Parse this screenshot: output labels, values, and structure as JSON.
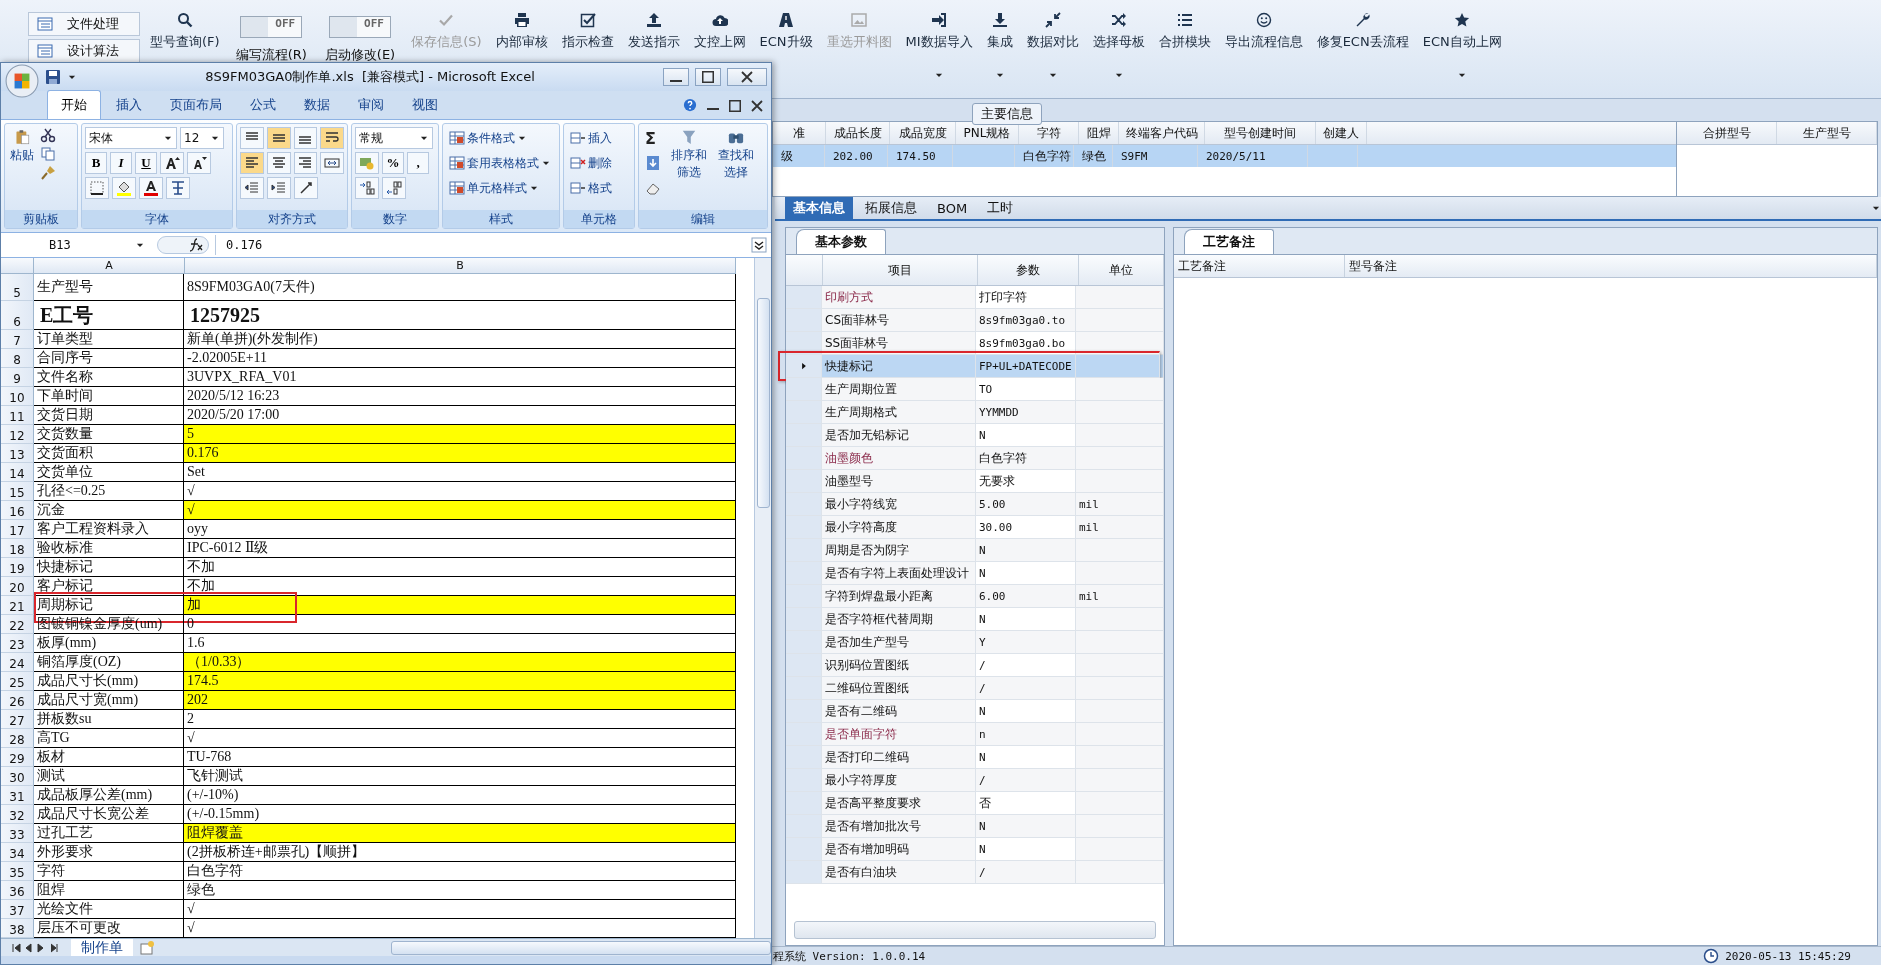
{
  "app": {
    "sidebar": {
      "items": [
        {
          "label": "文件处理"
        },
        {
          "label": "设计算法"
        }
      ]
    },
    "toolbar": [
      {
        "kind": "button",
        "label": "型号查询(F)",
        "disabled": false
      },
      {
        "kind": "toggle",
        "label": "编写流程(R)",
        "toggle_text": "OFF",
        "on": false
      },
      {
        "kind": "toggle",
        "label": "启动修改(E)",
        "toggle_text": "OFF",
        "on": false
      },
      {
        "kind": "button",
        "label": "保存信息(S)",
        "disabled": true
      },
      {
        "kind": "button",
        "label": "内部审核",
        "disabled": false
      },
      {
        "kind": "button",
        "label": "指示检查",
        "disabled": false
      },
      {
        "kind": "button",
        "label": "发送指示",
        "disabled": false
      },
      {
        "kind": "button",
        "label": "文控上网",
        "disabled": false
      },
      {
        "kind": "button",
        "label": "ECN升级",
        "disabled": false
      },
      {
        "kind": "button",
        "label": "重选开料图",
        "disabled": true
      },
      {
        "kind": "dropdown_button",
        "label": "MI数据导入",
        "disabled": false
      },
      {
        "kind": "dropdown_button",
        "label": "集成",
        "disabled": false
      },
      {
        "kind": "dropdown_button",
        "label": "数据对比",
        "disabled": false
      },
      {
        "kind": "dropdown_button",
        "label": "选择母板",
        "disabled": false
      },
      {
        "kind": "button",
        "label": "合拼模块",
        "disabled": false
      },
      {
        "kind": "button",
        "label": "导出流程信息",
        "disabled": false
      },
      {
        "kind": "button",
        "label": "修复ECN丢流程",
        "disabled": false
      },
      {
        "kind": "dropdown_button",
        "label": "ECN自动上网",
        "disabled": false
      }
    ],
    "main_info": {
      "title": "主要信息",
      "columns": [
        "准",
        "成品长度",
        "成品宽度",
        "PNL规格",
        "字符",
        "阻焊",
        "终端客户代码",
        "型号创建时间",
        "创建人"
      ],
      "rows": [
        {
          "selected": true,
          "cells": [
            "级",
            "202.00",
            "174.50",
            null,
            "白色字符",
            "绿色",
            "S9FM",
            "2020/5/11",
            null
          ]
        }
      ],
      "side_columns": [
        "合拼型号",
        "生产型号"
      ]
    },
    "tabs": [
      {
        "label": "基本信息",
        "selected": true
      },
      {
        "label": "拓展信息",
        "selected": false
      },
      {
        "label": "BOM",
        "selected": false
      },
      {
        "label": "工时",
        "selected": false
      }
    ],
    "params": {
      "tab": "基本参数",
      "columns": [
        "项目",
        "参数",
        "单位"
      ],
      "rows": [
        {
          "item": "印刷方式",
          "value": "打印字符",
          "required": true,
          "selected": false,
          "circled": false
        },
        {
          "item": "CS面菲林号",
          "value": "8s9fm03ga0.to",
          "required": false,
          "selected": false,
          "circled": false
        },
        {
          "item": "SS面菲林号",
          "value": "8s9fm03ga0.bo",
          "required": false,
          "selected": false,
          "circled": false
        },
        {
          "item": "快捷标记",
          "value": "FP+UL+DATECODE",
          "required": false,
          "selected": true,
          "circled": true
        },
        {
          "item": "生产周期位置",
          "value": "TO",
          "required": false,
          "selected": false,
          "circled": false
        },
        {
          "item": "生产周期格式",
          "value": "YYMMDD",
          "required": false,
          "selected": false,
          "circled": false
        },
        {
          "item": "是否加无铅标记",
          "value": "N",
          "required": false,
          "selected": false,
          "circled": false
        },
        {
          "item": "油墨颜色",
          "value": "白色字符",
          "required": true,
          "selected": false,
          "circled": false
        },
        {
          "item": "油墨型号",
          "value": "无要求",
          "required": false,
          "selected": false,
          "circled": false
        },
        {
          "item": "最小字符线宽",
          "value": "5.00",
          "unit": "mil",
          "required": false,
          "selected": false,
          "circled": false
        },
        {
          "item": "最小字符高度",
          "value": "30.00",
          "unit": "mil",
          "required": false,
          "selected": false,
          "circled": false
        },
        {
          "item": "周期是否为阴字",
          "value": "N",
          "required": false,
          "selected": false,
          "circled": false
        },
        {
          "item": "是否有字符上表面处理设计",
          "value": "N",
          "required": false,
          "selected": false,
          "circled": false
        },
        {
          "item": "字符到焊盘最小距离",
          "value": "6.00",
          "unit": "mil",
          "required": false,
          "selected": false,
          "circled": false
        },
        {
          "item": "是否字符框代替周期",
          "value": "N",
          "required": false,
          "selected": false,
          "circled": false
        },
        {
          "item": "是否加生产型号",
          "value": "Y",
          "required": false,
          "selected": false,
          "circled": false
        },
        {
          "item": "识别码位置图纸",
          "value": "/",
          "required": false,
          "selected": false,
          "circled": false
        },
        {
          "item": "二维码位置图纸",
          "value": "/",
          "required": false,
          "selected": false,
          "circled": false
        },
        {
          "item": "是否有二维码",
          "value": "N",
          "required": false,
          "selected": false,
          "circled": false
        },
        {
          "item": "是否单面字符",
          "value": "n",
          "required": true,
          "selected": false,
          "circled": false
        },
        {
          "item": "是否打印二维码",
          "value": "N",
          "required": false,
          "selected": false,
          "circled": false
        },
        {
          "item": "最小字符厚度",
          "value": "/",
          "required": false,
          "selected": false,
          "circled": false
        },
        {
          "item": "是否高平整度要求",
          "value": "否",
          "required": false,
          "selected": false,
          "circled": false
        },
        {
          "item": "是否有增加批次号",
          "value": "N",
          "required": false,
          "selected": false,
          "circled": false
        },
        {
          "item": "是否有增加明码",
          "value": "N",
          "required": false,
          "selected": false,
          "circled": false
        },
        {
          "item": "是否有白油块",
          "value": "/",
          "required": false,
          "selected": false,
          "circled": false
        }
      ]
    },
    "notes": {
      "tab": "工艺备注",
      "columns": [
        "工艺备注",
        "型号备注"
      ]
    },
    "status_bar": {
      "version": "程系统 Version: 1.0.0.14",
      "time": "2020-05-13 15:45:29"
    }
  },
  "excel": {
    "title": "8S9FM03GA0制作单.xls  [兼容模式] - Microsoft Excel",
    "ribbon_tabs": [
      {
        "label": "开始",
        "selected": true
      },
      {
        "label": "插入",
        "selected": false
      },
      {
        "label": "页面布局",
        "selected": false
      },
      {
        "label": "公式",
        "selected": false
      },
      {
        "label": "数据",
        "selected": false
      },
      {
        "label": "审阅",
        "selected": false
      },
      {
        "label": "视图",
        "selected": false
      }
    ],
    "ribbon": {
      "clipboard": {
        "label": "剪贴板",
        "paste": "粘贴"
      },
      "font": {
        "label": "字体",
        "font": "宋体",
        "size": "12",
        "buttons": [
          "B",
          "I",
          "U"
        ]
      },
      "alignment": {
        "label": "对齐方式"
      },
      "number": {
        "label": "数字",
        "format": "常规",
        "buttons": [
          "%",
          ","
        ]
      },
      "styles": {
        "label": "样式",
        "items": [
          "条件格式",
          "套用表格格式",
          "单元格样式"
        ]
      },
      "cells": {
        "label": "单元格",
        "items": [
          "插入",
          "删除",
          "格式"
        ]
      },
      "editing": {
        "label": "编辑",
        "sum": "Σ",
        "items": [
          "排序和筛选",
          "查找和选择"
        ]
      }
    },
    "name_box": "B13",
    "formula": "0.176",
    "columns": [
      "A",
      "B"
    ],
    "rows": [
      {
        "row": "5",
        "a": "生产型号",
        "b": "8S9FM03GA0(7天件)",
        "kind": "normal",
        "highlighted": false,
        "circled": false
      },
      {
        "row": "6",
        "a": "E工号",
        "b": "1257925",
        "kind": "title",
        "highlighted": false,
        "circled": false
      },
      {
        "row": "7",
        "a": "订单类型",
        "b": "新单(单拼)(外发制作)",
        "kind": "normal",
        "highlighted": false,
        "circled": false
      },
      {
        "row": "8",
        "a": "合同序号",
        "b": "-2.02005E+11",
        "kind": "normal",
        "highlighted": false,
        "circled": false
      },
      {
        "row": "9",
        "a": "文件名称",
        "b": "3UVPX_RFA_V01",
        "kind": "normal",
        "highlighted": false,
        "circled": false
      },
      {
        "row": "10",
        "a": "下单时间",
        "b": "2020/5/12 16:23",
        "kind": "normal",
        "highlighted": false,
        "circled": false
      },
      {
        "row": "11",
        "a": "交货日期",
        "b": "2020/5/20 17:00",
        "kind": "normal",
        "highlighted": false,
        "circled": false
      },
      {
        "row": "12",
        "a": "交货数量",
        "b": "5",
        "kind": "normal",
        "highlighted": true,
        "circled": false
      },
      {
        "row": "13",
        "a": "交货面积",
        "b": "0.176",
        "kind": "normal",
        "highlighted": true,
        "circled": false
      },
      {
        "row": "14",
        "a": "交货单位",
        "b": "Set",
        "kind": "normal",
        "highlighted": false,
        "circled": false
      },
      {
        "row": "15",
        "a": "孔径<=0.25",
        "b": "√",
        "kind": "normal",
        "highlighted": false,
        "circled": false
      },
      {
        "row": "16",
        "a": "沉金",
        "b": "√",
        "kind": "normal",
        "highlighted": true,
        "circled": false
      },
      {
        "row": "17",
        "a": "客户工程资料录入",
        "b": "oyy",
        "kind": "normal",
        "highlighted": false,
        "circled": false
      },
      {
        "row": "18",
        "a": "验收标准",
        "b": "IPC-6012 Ⅱ级",
        "kind": "normal",
        "highlighted": false,
        "circled": false
      },
      {
        "row": "19",
        "a": "快捷标记",
        "b": "不加",
        "kind": "normal",
        "highlighted": false,
        "circled": false
      },
      {
        "row": "20",
        "a": "客户标记",
        "b": "不加",
        "kind": "normal",
        "highlighted": false,
        "circled": false
      },
      {
        "row": "21",
        "a": "周期标记",
        "b": "加",
        "kind": "normal",
        "highlighted": true,
        "circled": true
      },
      {
        "row": "22",
        "a": "图镀铜镍金厚度(um)",
        "b": "0",
        "kind": "normal",
        "highlighted": false,
        "circled": false
      },
      {
        "row": "23",
        "a": "板厚(mm)",
        "b": "1.6",
        "kind": "normal",
        "highlighted": false,
        "circled": false
      },
      {
        "row": "24",
        "a": "铜箔厚度(OZ)",
        "b": "（1/0.33）",
        "kind": "normal",
        "highlighted": true,
        "circled": false
      },
      {
        "row": "25",
        "a": "成品尺寸长(mm)",
        "b": "174.5",
        "kind": "normal",
        "highlighted": true,
        "circled": false
      },
      {
        "row": "26",
        "a": "成品尺寸宽(mm)",
        "b": "202",
        "kind": "normal",
        "highlighted": true,
        "circled": false
      },
      {
        "row": "27",
        "a": "拼板数su",
        "b": "2",
        "kind": "normal",
        "highlighted": false,
        "circled": false
      },
      {
        "row": "28",
        "a": "高TG",
        "b": "√",
        "kind": "normal",
        "highlighted": false,
        "circled": false
      },
      {
        "row": "29",
        "a": "板材",
        "b": "TU-768",
        "kind": "normal",
        "highlighted": false,
        "circled": false
      },
      {
        "row": "30",
        "a": "测试",
        "b": "飞针测试",
        "kind": "normal",
        "highlighted": false,
        "circled": false
      },
      {
        "row": "31",
        "a": "成品板厚公差(mm)",
        "b": "(+/-10%)",
        "kind": "normal",
        "highlighted": false,
        "circled": false
      },
      {
        "row": "32",
        "a": "成品尺寸长宽公差",
        "b": "(+/-0.15mm)",
        "kind": "normal",
        "highlighted": false,
        "circled": false
      },
      {
        "row": "33",
        "a": "过孔工艺",
        "b": "阻焊覆盖",
        "kind": "normal",
        "highlighted": true,
        "circled": false
      },
      {
        "row": "34",
        "a": "外形要求",
        "b": "(2拼板桥连+邮票孔)【顺拼】",
        "kind": "normal",
        "highlighted": false,
        "circled": false
      },
      {
        "row": "35",
        "a": "字符",
        "b": "白色字符",
        "kind": "normal",
        "highlighted": false,
        "circled": false
      },
      {
        "row": "36",
        "a": "阻焊",
        "b": "绿色",
        "kind": "normal",
        "highlighted": false,
        "circled": false
      },
      {
        "row": "37",
        "a": "光绘文件",
        "b": "√",
        "kind": "normal",
        "highlighted": false,
        "circled": false
      },
      {
        "row": "38",
        "a": "层压不可更改",
        "b": "√",
        "kind": "normal",
        "highlighted": false,
        "circled": false
      }
    ],
    "sheet_tabs": [
      {
        "label": "制作单",
        "selected": true
      }
    ]
  }
}
